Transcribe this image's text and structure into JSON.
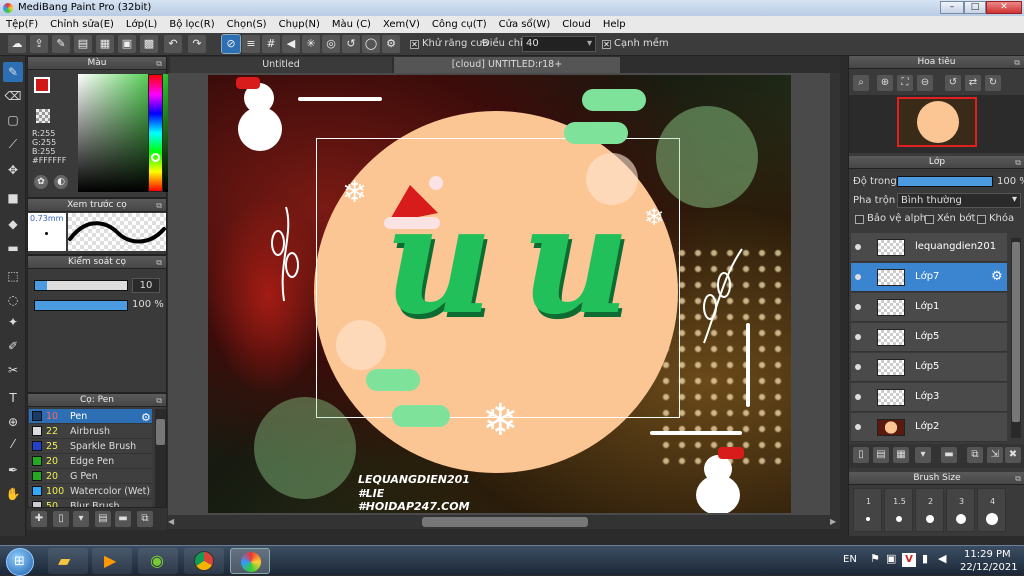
{
  "window": {
    "title": "MediBang Paint Pro (32bit)",
    "minimize": "–",
    "maximize": "□",
    "close": "✕"
  },
  "menu": [
    "Tệp(F)",
    "Chỉnh sửa(E)",
    "Lớp(L)",
    "Bộ lọc(R)",
    "Chọn(S)",
    "Chụp(N)",
    "Màu (C)",
    "Xem(V)",
    "Công cụ(T)",
    "Cửa sổ(W)",
    "Cloud",
    "Help"
  ],
  "toolbar": {
    "antialias_label": "Khử răng cưa",
    "antialias_checked": "✕",
    "adjust_label": "Điều chỉnh",
    "adjust_value": "40",
    "sharp_label": "Cạnh mềm",
    "sharp_checked": "✕"
  },
  "color_panel": {
    "title": "Màu",
    "r": "R:255",
    "g": "G:255",
    "b": "B:255",
    "hex": "#FFFFFF",
    "primary": "#d01818",
    "secondary": "#ffffff"
  },
  "brush_preview": {
    "title": "Xem trước cọ",
    "size": "0.73mm"
  },
  "brush_control": {
    "title": "Kiểm soát cọ",
    "size_value": "10",
    "size_fill": 0.13,
    "opacity_value": "100 %",
    "opacity_fill": 1.0
  },
  "brush_list": {
    "title": "Cọ: Pen",
    "items": [
      {
        "num": "10",
        "name": "Pen",
        "color": "#1a3a6a"
      },
      {
        "num": "22",
        "name": "Airbrush",
        "color": "#dddddd"
      },
      {
        "num": "25",
        "name": "Sparkle Brush",
        "color": "#2244cc"
      },
      {
        "num": "20",
        "name": "Edge Pen",
        "color": "#22aa22"
      },
      {
        "num": "20",
        "name": "G Pen",
        "color": "#22aa22"
      },
      {
        "num": "100",
        "name": "Watercolor (Wet)",
        "color": "#33aaff"
      },
      {
        "num": "50",
        "name": "Blur Brush",
        "color": "#cccccc"
      }
    ]
  },
  "doc_tabs": [
    "Untitled",
    "[cloud] UNTITLED:r18+"
  ],
  "artwork": {
    "text": "uu",
    "sig1": "LEQUANGDIEN201",
    "sig2": "#LIE",
    "sig3": "#HOIDAP247.COM",
    "circle_color": "#fcc594",
    "letter_color": "#22c05a"
  },
  "navigator": {
    "title": "Hoa tiêu"
  },
  "layer_panel": {
    "title": "Lớp",
    "opacity_label": "Độ trong",
    "opacity_value": "100 %",
    "opacity_fill": 1.0,
    "blend_label": "Pha trộn",
    "blend_value": "Bình thường",
    "protect_alpha": "Bảo vệ alpha",
    "clipping": "Xén bớt",
    "lock": "Khóa",
    "layers": [
      "lequangdien201",
      "Lớp7",
      "Lớp1",
      "Lớp5",
      "Lớp5",
      "Lớp3",
      "Lớp2"
    ],
    "selected_index": 1
  },
  "brush_size": {
    "title": "Brush Size",
    "sizes": [
      "1",
      "1.5",
      "2",
      "3",
      "4"
    ]
  },
  "taskbar": {
    "lang": "EN",
    "time": "11:29 PM",
    "date": "22/12/2021"
  }
}
